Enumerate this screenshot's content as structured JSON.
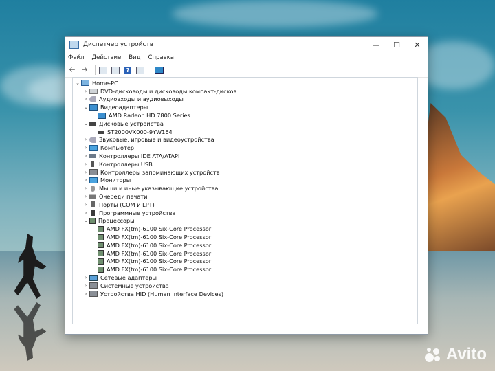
{
  "window": {
    "title": "Диспетчер устройств",
    "controls": {
      "minimize": "—",
      "maximize": "☐",
      "close": "✕"
    }
  },
  "menu": [
    "Файл",
    "Действие",
    "Вид",
    "Справка"
  ],
  "toolbar": [
    {
      "name": "back-button",
      "icon": "arrow-left-icon"
    },
    {
      "name": "forward-button",
      "icon": "arrow-right-icon"
    },
    {
      "name": "properties-button",
      "icon": "properties-icon"
    },
    {
      "name": "console-tree-button",
      "icon": "console-tree-icon"
    },
    {
      "name": "help-button",
      "icon": "help-icon"
    },
    {
      "name": "driver-info-button",
      "icon": "driver-icon"
    },
    {
      "name": "scan-hardware-button",
      "icon": "monitor-icon"
    }
  ],
  "tree": [
    {
      "level": 0,
      "expander": "expanded",
      "icon": "pc",
      "label": "Home-PC"
    },
    {
      "level": 1,
      "expander": "collapsed",
      "icon": "disk",
      "label": "DVD-дисководы и дисководы компакт-дисков"
    },
    {
      "level": 1,
      "expander": "collapsed",
      "icon": "snd",
      "label": "Аудиовходы и аудиовыходы"
    },
    {
      "level": 1,
      "expander": "expanded",
      "icon": "gpu",
      "label": "Видеоадаптеры"
    },
    {
      "level": 2,
      "expander": "none",
      "icon": "gpu",
      "label": "AMD Radeon HD 7800 Series"
    },
    {
      "level": 1,
      "expander": "expanded",
      "icon": "blk",
      "label": "Дисковые устройства"
    },
    {
      "level": 2,
      "expander": "none",
      "icon": "blk",
      "label": "ST2000VX000-9YW164"
    },
    {
      "level": 1,
      "expander": "collapsed",
      "icon": "snd",
      "label": "Звуковые, игровые и видеоустройства"
    },
    {
      "level": 1,
      "expander": "collapsed",
      "icon": "mon",
      "label": "Компьютер"
    },
    {
      "level": 1,
      "expander": "collapsed",
      "icon": "ide",
      "label": "Контроллеры IDE ATA/ATAPI"
    },
    {
      "level": 1,
      "expander": "collapsed",
      "icon": "usb",
      "label": "Контроллеры USB"
    },
    {
      "level": 1,
      "expander": "collapsed",
      "icon": "grey",
      "label": "Контроллеры запоминающих устройств"
    },
    {
      "level": 1,
      "expander": "collapsed",
      "icon": "mon",
      "label": "Мониторы"
    },
    {
      "level": 1,
      "expander": "collapsed",
      "icon": "mouse",
      "label": "Мыши и иные указывающие устройства"
    },
    {
      "level": 1,
      "expander": "collapsed",
      "icon": "print",
      "label": "Очереди печати"
    },
    {
      "level": 1,
      "expander": "collapsed",
      "icon": "port",
      "label": "Порты (COM и LPT)"
    },
    {
      "level": 1,
      "expander": "collapsed",
      "icon": "soft",
      "label": "Программные устройства"
    },
    {
      "level": 1,
      "expander": "expanded",
      "icon": "chip",
      "label": "Процессоры"
    },
    {
      "level": 2,
      "expander": "none",
      "icon": "chip",
      "label": "AMD FX(tm)-6100 Six-Core Processor"
    },
    {
      "level": 2,
      "expander": "none",
      "icon": "chip",
      "label": "AMD FX(tm)-6100 Six-Core Processor"
    },
    {
      "level": 2,
      "expander": "none",
      "icon": "chip",
      "label": "AMD FX(tm)-6100 Six-Core Processor"
    },
    {
      "level": 2,
      "expander": "none",
      "icon": "chip",
      "label": "AMD FX(tm)-6100 Six-Core Processor"
    },
    {
      "level": 2,
      "expander": "none",
      "icon": "chip",
      "label": "AMD FX(tm)-6100 Six-Core Processor"
    },
    {
      "level": 2,
      "expander": "none",
      "icon": "chip",
      "label": "AMD FX(tm)-6100 Six-Core Processor"
    },
    {
      "level": 1,
      "expander": "collapsed",
      "icon": "net",
      "label": "Сетевые адаптеры"
    },
    {
      "level": 1,
      "expander": "collapsed",
      "icon": "grey",
      "label": "Системные устройства"
    },
    {
      "level": 1,
      "expander": "collapsed",
      "icon": "grey",
      "label": "Устройства HID (Human Interface Devices)"
    }
  ],
  "watermark": {
    "text": "Avito"
  }
}
